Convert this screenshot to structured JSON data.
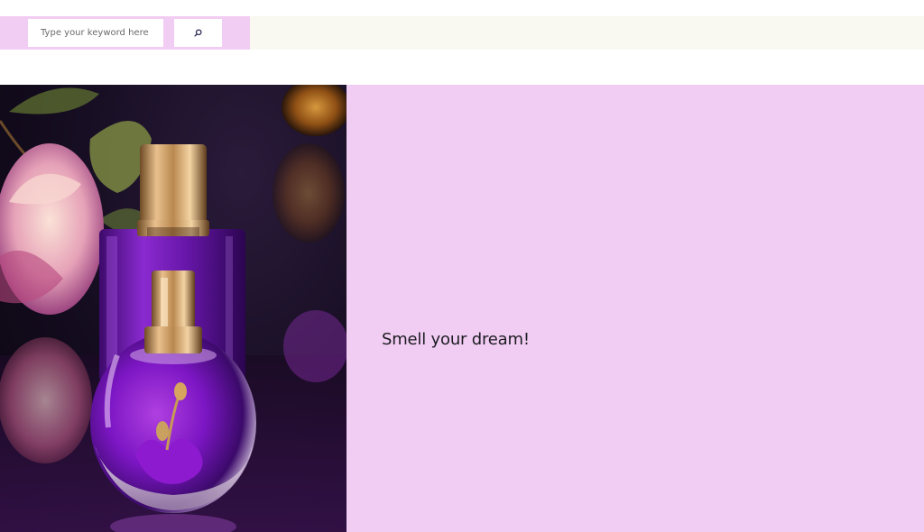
{
  "search": {
    "placeholder": "Type your keyword here",
    "button_icon": "search-icon"
  },
  "hero": {
    "image_alt_subject": "perfume bottles",
    "tagline": "Smell your dream!"
  },
  "colors": {
    "pink_accent": "#f2cdf3",
    "cream_bar": "#f9f8f1",
    "purple": "#7a1bbf",
    "gold": "#c89a5c"
  }
}
